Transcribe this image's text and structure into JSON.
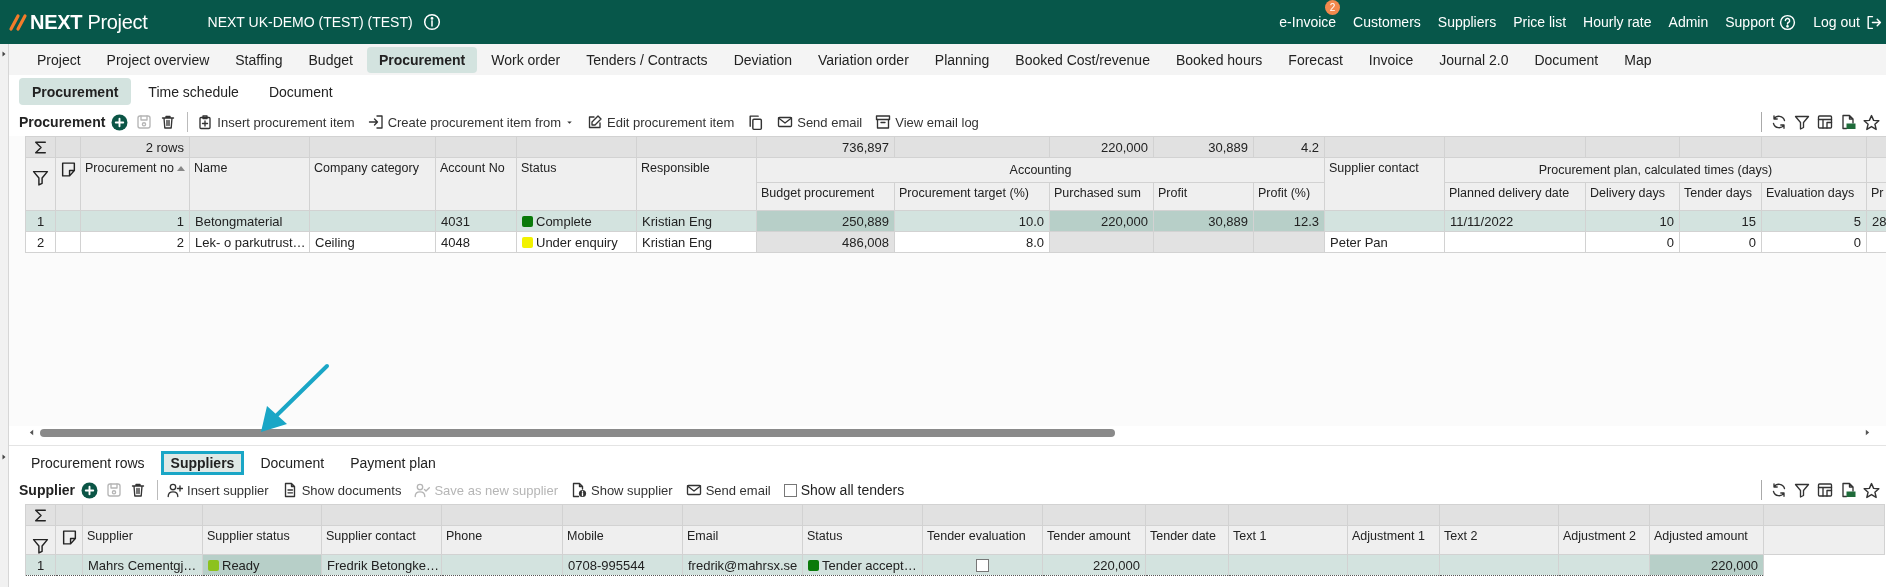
{
  "header": {
    "logo": "**NEXT** Project",
    "project_title": "NEXT UK-DEMO (TEST) (TEST)",
    "links": [
      {
        "label": "e-Invoice",
        "kind": "plain",
        "badge": "2"
      },
      {
        "label": "Customers",
        "kind": "plain"
      },
      {
        "label": "Suppliers",
        "kind": "plain"
      },
      {
        "label": "Price list",
        "kind": "plain"
      },
      {
        "label": "Hourly rate",
        "kind": "plain"
      },
      {
        "label": "Admin",
        "kind": "plain"
      },
      {
        "label": "Support",
        "kind": "help"
      },
      {
        "label": "Log out",
        "kind": "logout"
      }
    ]
  },
  "main_tabs": [
    {
      "label": "Project",
      "selected": false
    },
    {
      "label": "Project overview",
      "selected": false
    },
    {
      "label": "Staffing",
      "selected": false
    },
    {
      "label": "Budget",
      "selected": false
    },
    {
      "label": "Procurement",
      "selected": true
    },
    {
      "label": "Work order",
      "selected": false
    },
    {
      "label": "Tenders / Contracts",
      "selected": false
    },
    {
      "label": "Deviation",
      "selected": false
    },
    {
      "label": "Variation order",
      "selected": false
    },
    {
      "label": "Planning",
      "selected": false
    },
    {
      "label": "Booked Cost/revenue",
      "selected": false
    },
    {
      "label": "Booked hours",
      "selected": false
    },
    {
      "label": "Forecast",
      "selected": false
    },
    {
      "label": "Invoice",
      "selected": false
    },
    {
      "label": "Journal 2.0",
      "selected": false
    },
    {
      "label": "Document",
      "selected": false
    },
    {
      "label": "Map",
      "selected": false
    }
  ],
  "sub_tabs": [
    {
      "label": "Procurement",
      "selected": true
    },
    {
      "label": "Time schedule",
      "selected": false
    },
    {
      "label": "Document",
      "selected": false
    }
  ],
  "procurement_toolbar": {
    "title": "Procurement",
    "buttons": [
      {
        "kind": "add",
        "disabled": false
      },
      {
        "kind": "save",
        "disabled": true
      },
      {
        "kind": "delete",
        "disabled": false
      }
    ],
    "actions": [
      {
        "kind": "insert",
        "label": "Insert procurement item",
        "disabled": false
      },
      {
        "kind": "create_from",
        "label": "Create procurement item from",
        "disabled": false
      },
      {
        "kind": "edit",
        "label": "Edit procurement item",
        "disabled": false
      },
      {
        "kind": "copy",
        "disabled": false
      },
      {
        "kind": "email",
        "label": "Send email",
        "disabled": false
      },
      {
        "kind": "email_log",
        "label": "View email log",
        "disabled": false
      }
    ]
  },
  "procurement_grid": {
    "header": [
      {
        "label": "Procurement no",
        "kind": "number",
        "sort_ascending": true,
        "sum": "2 rows",
        "readonly": false
      },
      {
        "label": "Name",
        "kind": "text",
        "readonly": false
      },
      {
        "label": "Company category",
        "kind": "text",
        "readonly": false
      },
      {
        "label": "Account No",
        "kind": "text",
        "readonly": false
      },
      {
        "label": "Status",
        "kind": "status",
        "readonly": false
      },
      {
        "label": "Responsible",
        "kind": "text",
        "readonly": false
      },
      {
        "label": "Accounting",
        "columns": [
          {
            "label": "Budget procurement",
            "kind": "number",
            "sum": "736,897",
            "readonly": true
          },
          {
            "label": "Procurement target (%)",
            "kind": "number",
            "readonly": false
          },
          {
            "label": "Purchased sum",
            "kind": "number",
            "sum": "220,000",
            "readonly": true
          },
          {
            "label": "Profit",
            "kind": "number",
            "sum": "30,889",
            "readonly": true
          },
          {
            "label": "Profit (%)",
            "kind": "number",
            "sum": "4.2",
            "readonly": true
          }
        ]
      },
      {
        "label": "Supplier contact",
        "kind": "text",
        "readonly": false
      },
      {
        "label": "Procurement plan, calculated times (days)",
        "columns": [
          {
            "label": "Planned delivery date",
            "kind": "text",
            "readonly": false
          },
          {
            "label": "Delivery days",
            "kind": "number",
            "readonly": false
          },
          {
            "label": "Tender days",
            "kind": "number",
            "readonly": false
          },
          {
            "label": "Evaluation days",
            "kind": "number",
            "readonly": false
          }
        ]
      },
      {
        "columns": [
          {
            "label": "Pr",
            "kind": "text",
            "readonly": false
          }
        ]
      }
    ],
    "rows": [
      {
        "row_number": "1",
        "selected": true,
        "cells": [
          "1",
          "Betongmaterial",
          null,
          "4031",
          {
            "text": "Complete",
            "color": "#0a7a0a"
          },
          "Kristian Eng",
          "250,889",
          "10.0",
          "220,000",
          "30,889",
          "12.3",
          null,
          "11/11/2022",
          "10",
          "15",
          "5",
          "28"
        ]
      },
      {
        "row_number": "2",
        "selected": false,
        "cells": [
          "2",
          "Lek- o parkutrust…",
          "Ceiling",
          "4048",
          {
            "text": "Under enquiry",
            "color": "#f2f200"
          },
          "Kristian Eng",
          "486,008",
          "8.0",
          null,
          null,
          null,
          "Peter Pan",
          null,
          "0",
          "0",
          "0",
          null
        ]
      }
    ]
  },
  "bottom_tabs": [
    {
      "label": "Procurement rows",
      "selected": false,
      "highlighted": false
    },
    {
      "label": "Suppliers",
      "selected": true,
      "highlighted": true
    },
    {
      "label": "Document",
      "selected": false,
      "highlighted": false
    },
    {
      "label": "Payment plan",
      "selected": false,
      "highlighted": false
    }
  ],
  "supplier_toolbar": {
    "title": "Supplier",
    "buttons": [
      {
        "kind": "add",
        "disabled": false
      },
      {
        "kind": "save",
        "disabled": true
      },
      {
        "kind": "delete",
        "disabled": false
      }
    ],
    "actions": [
      {
        "kind": "insert_supplier",
        "label": "Insert supplier",
        "disabled": false
      },
      {
        "kind": "documents",
        "label": "Show documents",
        "disabled": false
      },
      {
        "kind": "save_as_new",
        "label": "Save as new supplier",
        "disabled": true
      },
      {
        "kind": "show_supplier",
        "label": "Show supplier",
        "disabled": false
      },
      {
        "kind": "email",
        "label": "Send email",
        "disabled": false
      },
      {
        "kind": "checkbox",
        "label": "Show all tenders",
        "checked": false,
        "disabled": false
      }
    ]
  },
  "supplier_grid": {
    "header": [
      {
        "label": "Supplier",
        "kind": "text",
        "readonly": false
      },
      {
        "label": "Supplier status",
        "kind": "status",
        "readonly": true
      },
      {
        "label": "Supplier contact",
        "kind": "text",
        "readonly": false
      },
      {
        "label": "Phone",
        "kind": "text",
        "readonly": false
      },
      {
        "label": "Mobile",
        "kind": "text",
        "readonly": false
      },
      {
        "label": "Email",
        "kind": "text",
        "readonly": false
      },
      {
        "label": "Status",
        "kind": "status",
        "readonly": false
      },
      {
        "label": "Tender evaluation",
        "kind": "check",
        "readonly": false
      },
      {
        "label": "Tender amount",
        "kind": "number",
        "readonly": false
      },
      {
        "label": "Tender date",
        "kind": "text",
        "readonly": false
      },
      {
        "label": "Text 1",
        "kind": "text",
        "readonly": false
      },
      {
        "label": "Adjustment 1",
        "kind": "number",
        "readonly": false
      },
      {
        "label": "Text 2",
        "kind": "text",
        "readonly": false
      },
      {
        "label": "Adjustment 2",
        "kind": "number",
        "readonly": false
      },
      {
        "label": "Adjusted amount",
        "kind": "number",
        "readonly": true
      }
    ],
    "rows": [
      {
        "row_number": "1",
        "selected": true,
        "cells": [
          "Mahrs Cementgj…",
          {
            "text": "Ready",
            "color": "#8cc21e"
          },
          "Fredrik Betongke…",
          null,
          "0708-995544",
          "fredrik@mahrsx.se",
          {
            "text": "Tender accept…",
            "color": "#0a7a0a"
          },
          {
            "checked": false
          },
          "220,000",
          null,
          null,
          null,
          null,
          null,
          "220,000"
        ]
      }
    ]
  }
}
